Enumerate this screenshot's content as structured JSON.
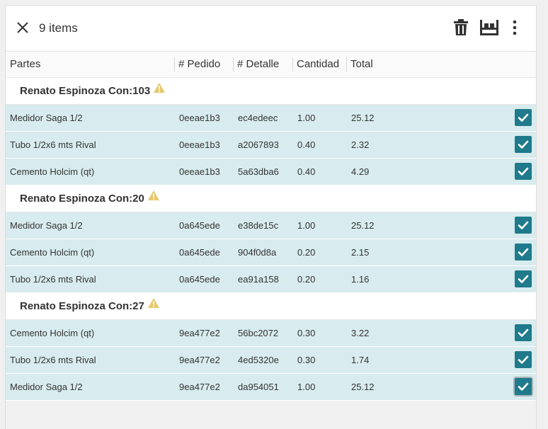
{
  "toolbar": {
    "count_label": "9 items",
    "close_icon": "close-icon",
    "delete_icon": "trash-icon",
    "layout_icon": "bunk-layout-icon",
    "more_icon": "more-vertical-icon"
  },
  "columns": [
    "Partes",
    "# Pedido",
    "# Detalle",
    "Cantidad",
    "Total"
  ],
  "colors": {
    "row_bg": "#d8ebee",
    "check": "#1f7a8c",
    "warning": "#e6c96b"
  },
  "groups": [
    {
      "title": "Renato Espinoza Con:103",
      "rows": [
        {
          "part": "Medidor Saga 1/2",
          "pedido": "0eeae1b3",
          "detalle": "ec4edeec",
          "cantidad": "1.00",
          "total": "25.12",
          "checked": true
        },
        {
          "part": "Tubo 1/2x6 mts Rival",
          "pedido": "0eeae1b3",
          "detalle": "a2067893",
          "cantidad": "0.40",
          "total": "2.32",
          "checked": true
        },
        {
          "part": "Cemento Holcim (qt)",
          "pedido": "0eeae1b3",
          "detalle": "5a63dba6",
          "cantidad": "0.40",
          "total": "4.29",
          "checked": true
        }
      ]
    },
    {
      "title": "Renato Espinoza Con:20",
      "rows": [
        {
          "part": "Medidor Saga 1/2",
          "pedido": "0a645ede",
          "detalle": "e38de15c",
          "cantidad": "1.00",
          "total": "25.12",
          "checked": true
        },
        {
          "part": "Cemento Holcim (qt)",
          "pedido": "0a645ede",
          "detalle": "904f0d8a",
          "cantidad": "0.20",
          "total": "2.15",
          "checked": true
        },
        {
          "part": "Tubo 1/2x6 mts Rival",
          "pedido": "0a645ede",
          "detalle": "ea91a158",
          "cantidad": "0.20",
          "total": "1.16",
          "checked": true
        }
      ]
    },
    {
      "title": "Renato Espinoza Con:27",
      "rows": [
        {
          "part": "Cemento Holcim (qt)",
          "pedido": "9ea477e2",
          "detalle": "56bc2072",
          "cantidad": "0.30",
          "total": "3.22",
          "checked": true
        },
        {
          "part": "Tubo 1/2x6 mts Rival",
          "pedido": "9ea477e2",
          "detalle": "4ed5320e",
          "cantidad": "0.30",
          "total": "1.74",
          "checked": true
        },
        {
          "part": "Medidor Saga 1/2",
          "pedido": "9ea477e2",
          "detalle": "da954051",
          "cantidad": "1.00",
          "total": "25.12",
          "checked": true
        }
      ]
    }
  ]
}
